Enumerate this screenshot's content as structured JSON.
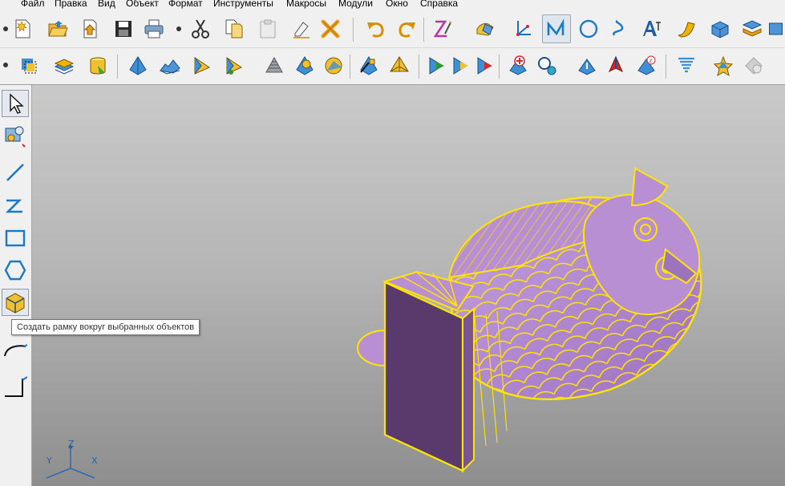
{
  "menu": [
    "Файл",
    "Правка",
    "Вид",
    "Объект",
    "Формат",
    "Инструменты",
    "Макросы",
    "Модули",
    "Окно",
    "Справка"
  ],
  "toolbar1": {
    "buttons": [
      "new-file-icon",
      "open-folder-icon",
      "import-icon",
      "save-icon",
      "print-icon",
      "cut-icon",
      "copy-icon",
      "paste-icon",
      "eraser-icon",
      "delete-icon",
      "undo-icon",
      "redo-icon",
      "z-spline-icon",
      "surface-icon",
      "axis-system-icon",
      "polyline-icon",
      "circle-icon",
      "spline-icon",
      "text-icon",
      "ribbon-surface-icon",
      "box-icon",
      "layers-icon",
      "more-icon"
    ]
  },
  "toolbar2": {
    "buttons": [
      "select-box-icon",
      "cube-stack-icon",
      "cylinder-icon",
      "extrude-icon",
      "terrain-icon",
      "sweep-icon",
      "rotate-surface-icon",
      "grid-pattern-icon",
      "lens-icon",
      "sphere-icon",
      "mesh-edit-icon",
      "pyramid-icon",
      "split-icon",
      "mirror-icon",
      "trim-icon",
      "add-point-icon",
      "magnify-icon",
      "check-vertex-icon",
      "arrow-vertex-icon",
      "height-icon",
      "tornado-icon",
      "star-icon",
      "disabled-icon"
    ]
  },
  "left_panel": [
    "select-arrow-icon",
    "settings-tools-icon",
    "line-icon",
    "polyline-icon",
    "rectangle-icon",
    "hexagon-icon",
    "bounding-box-icon",
    "arc-icon",
    "corner-icon"
  ],
  "tooltip": "Создать рамку вокруг выбранных объектов",
  "axes": {
    "z": "Z",
    "y": "Y",
    "x": "X"
  },
  "colors": {
    "model": "#b88fd3",
    "model_dark": "#5a3a6c",
    "edges": "#ffe600",
    "viewport_top": "#c9c9c9",
    "viewport_bottom": "#8e8e8e"
  }
}
